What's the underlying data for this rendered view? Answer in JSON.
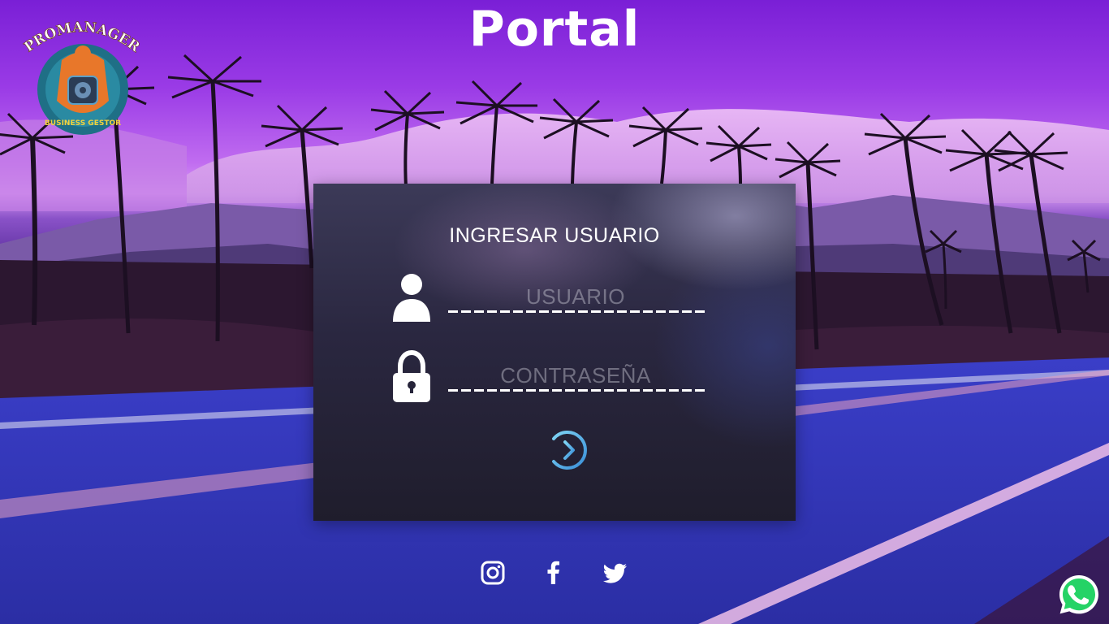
{
  "header": {
    "title": "Portal",
    "logo": {
      "brand": "PROMANAGER",
      "tagline": "BUSINESS GESTOR",
      "icon": "gear-shield-logo"
    }
  },
  "login": {
    "title": "INGRESAR USUARIO",
    "username": {
      "placeholder": "USUARIO",
      "value": "",
      "icon": "user-icon"
    },
    "password": {
      "placeholder": "CONTRASEÑA",
      "value": "",
      "icon": "lock-icon"
    },
    "submit": {
      "icon": "login-arrow-icon",
      "color": "#4fb8e8"
    }
  },
  "social": [
    {
      "name": "instagram",
      "icon": "instagram-icon"
    },
    {
      "name": "facebook",
      "icon": "facebook-icon"
    },
    {
      "name": "twitter",
      "icon": "twitter-icon"
    }
  ],
  "whatsapp": {
    "icon": "whatsapp-icon",
    "color": "#25d366"
  },
  "colors": {
    "text": "#ffffff",
    "card_background": "#26243a",
    "accent": "#4fb8e8"
  }
}
